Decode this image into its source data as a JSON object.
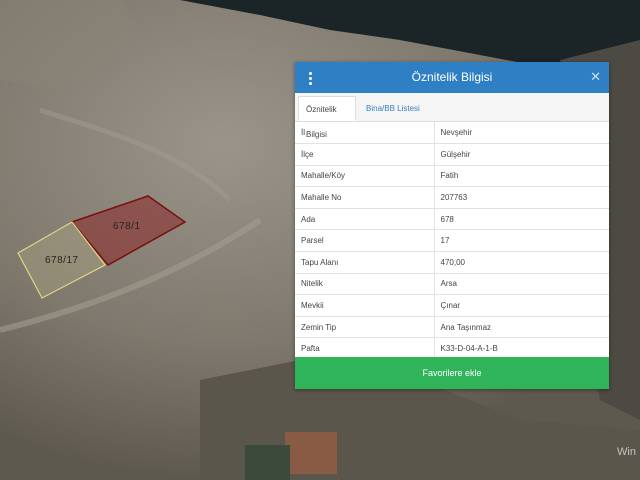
{
  "map": {
    "parcels": [
      {
        "label": "678/1"
      },
      {
        "label": "678/17"
      }
    ],
    "watermark_text": "Win"
  },
  "panel": {
    "title": "Öznitelik Bilgisi",
    "menu_icon": "vertical-dots-icon",
    "close_icon": "close-icon",
    "tabs": [
      {
        "label": "Öznitelik Bilgisi",
        "active": true
      },
      {
        "label": "Bina/BB Listesi",
        "active": false
      }
    ],
    "rows": [
      {
        "key": "İl",
        "value": "Nevşehir"
      },
      {
        "key": "İlçe",
        "value": "Gülşehir"
      },
      {
        "key": "Mahalle/Köy",
        "value": "Fatih"
      },
      {
        "key": "Mahalle No",
        "value": "207763"
      },
      {
        "key": "Ada",
        "value": "678"
      },
      {
        "key": "Parsel",
        "value": "17"
      },
      {
        "key": "Tapu Alanı",
        "value": "470,00"
      },
      {
        "key": "Nitelik",
        "value": "Arsa"
      },
      {
        "key": "Mevkii",
        "value": "Çınar"
      },
      {
        "key": "Zemin Tip",
        "value": "Ana Taşınmaz"
      },
      {
        "key": "Pafta",
        "value": "K33-D-04-A-1-B"
      }
    ],
    "favorite_button": "Favorilere ekle",
    "colors": {
      "header": "#2e7fc4",
      "button": "#2fb45a",
      "tab_link": "#3a7fc0"
    }
  }
}
